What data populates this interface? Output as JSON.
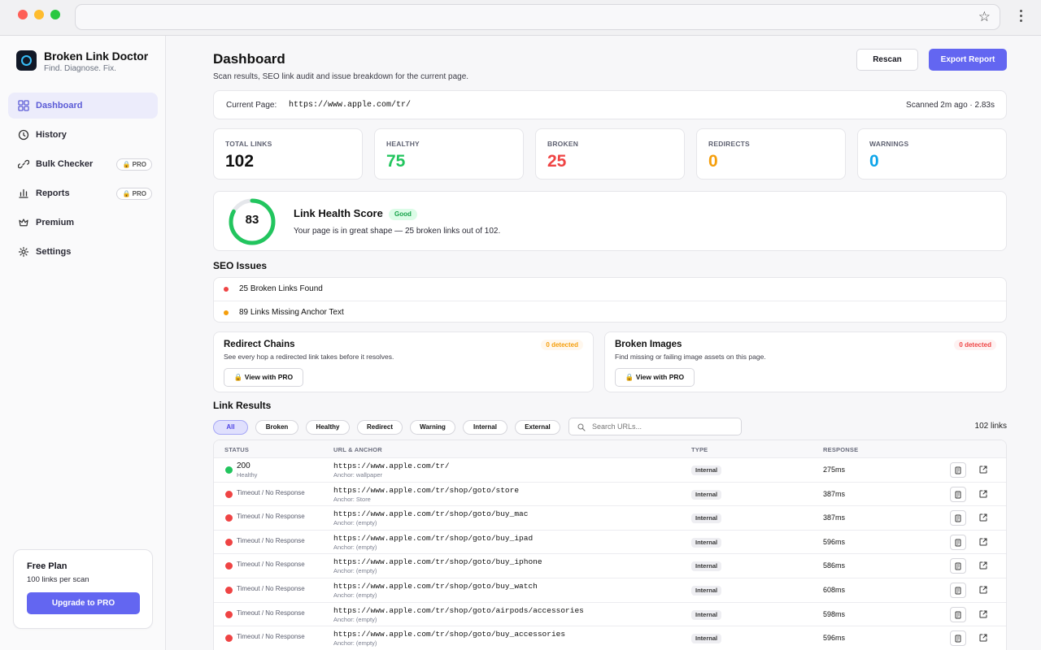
{
  "app": {
    "name": "Broken Link Doctor",
    "tagline": "Find. Diagnose. Fix."
  },
  "sidebar": {
    "items": [
      {
        "label": "Dashboard",
        "icon": "grid-icon",
        "active": true
      },
      {
        "label": "History",
        "icon": "clock-icon"
      },
      {
        "label": "Bulk Checker",
        "icon": "link-icon",
        "badge": "PRO"
      },
      {
        "label": "Reports",
        "icon": "bar-chart-icon",
        "badge": "PRO"
      },
      {
        "label": "Premium",
        "icon": "crown-icon"
      },
      {
        "label": "Settings",
        "icon": "gear-icon"
      }
    ],
    "plan": {
      "title": "Free Plan",
      "subtitle": "100 links per scan",
      "button": "Upgrade to PRO"
    }
  },
  "header": {
    "title": "Dashboard",
    "subtitle": "Scan results, SEO link audit and issue breakdown for the current page.",
    "rescan": "Rescan",
    "export": "Export Report"
  },
  "current_page": {
    "label": "Current Page:",
    "url": "https://www.apple.com/tr/",
    "meta": "Scanned 2m ago · 2.83s"
  },
  "stats": [
    {
      "label": "TOTAL LINKS",
      "value": "102",
      "color": "#111111"
    },
    {
      "label": "HEALTHY",
      "value": "75",
      "color": "#22c55e"
    },
    {
      "label": "BROKEN",
      "value": "25",
      "color": "#ef4444"
    },
    {
      "label": "REDIRECTS",
      "value": "0",
      "color": "#f59e0b"
    },
    {
      "label": "WARNINGS",
      "value": "0",
      "color": "#0ea5e9"
    }
  ],
  "health": {
    "score": "83",
    "score_fraction": 0.83,
    "title": "Link Health Score",
    "badge": "Good",
    "text": "Your page is in great shape — 25 broken links out of 102."
  },
  "seo": {
    "title": "SEO Issues",
    "issues": [
      {
        "text": "25 Broken Links Found",
        "color": "#ef4444"
      },
      {
        "text": "89 Links Missing Anchor Text",
        "color": "#f59e0b"
      }
    ]
  },
  "features": [
    {
      "title": "Redirect Chains",
      "subtitle": "See every hop a redirected link takes before it resolves.",
      "badge": "0 detected",
      "badge_color": "#f59e0b",
      "badge_bg": "#fff7ed",
      "button": "View with PRO"
    },
    {
      "title": "Broken Images",
      "subtitle": "Find missing or failing image assets on this page.",
      "badge": "0 detected",
      "badge_color": "#ef4444",
      "badge_bg": "#fef2f2",
      "button": "View with PRO"
    }
  ],
  "results": {
    "title": "Link Results",
    "filters": [
      "All",
      "Broken",
      "Healthy",
      "Redirect",
      "Warning",
      "Internal",
      "External"
    ],
    "search_placeholder": "Search URLs...",
    "count": "102 links",
    "columns": [
      "STATUS",
      "URL & ANCHOR",
      "TYPE",
      "RESPONSE"
    ],
    "rows": [
      {
        "status_code": "200",
        "status": "Healthy",
        "status_color": "#22c55e",
        "url": "https://www.apple.com/tr/",
        "anchor": "Anchor: wallpaper",
        "type": "Internal",
        "response": "275ms"
      },
      {
        "status": "Timeout / No Response",
        "status_color": "#ef4444",
        "url": "https://www.apple.com/tr/shop/goto/store",
        "anchor": "Anchor: Store",
        "type": "Internal",
        "response": "387ms"
      },
      {
        "status": "Timeout / No Response",
        "status_color": "#ef4444",
        "url": "https://www.apple.com/tr/shop/goto/buy_mac",
        "anchor": "Anchor: (empty)",
        "type": "Internal",
        "response": "387ms"
      },
      {
        "status": "Timeout / No Response",
        "status_color": "#ef4444",
        "url": "https://www.apple.com/tr/shop/goto/buy_ipad",
        "anchor": "Anchor: (empty)",
        "type": "Internal",
        "response": "596ms"
      },
      {
        "status": "Timeout / No Response",
        "status_color": "#ef4444",
        "url": "https://www.apple.com/tr/shop/goto/buy_iphone",
        "anchor": "Anchor: (empty)",
        "type": "Internal",
        "response": "586ms"
      },
      {
        "status": "Timeout / No Response",
        "status_color": "#ef4444",
        "url": "https://www.apple.com/tr/shop/goto/buy_watch",
        "anchor": "Anchor: (empty)",
        "type": "Internal",
        "response": "608ms"
      },
      {
        "status": "Timeout / No Response",
        "status_color": "#ef4444",
        "url": "https://www.apple.com/tr/shop/goto/airpods/accessories",
        "anchor": "Anchor: (empty)",
        "type": "Internal",
        "response": "598ms"
      },
      {
        "status": "Timeout / No Response",
        "status_color": "#ef4444",
        "url": "https://www.apple.com/tr/shop/goto/buy_accessories",
        "anchor": "Anchor: (empty)",
        "type": "Internal",
        "response": "596ms"
      }
    ]
  }
}
